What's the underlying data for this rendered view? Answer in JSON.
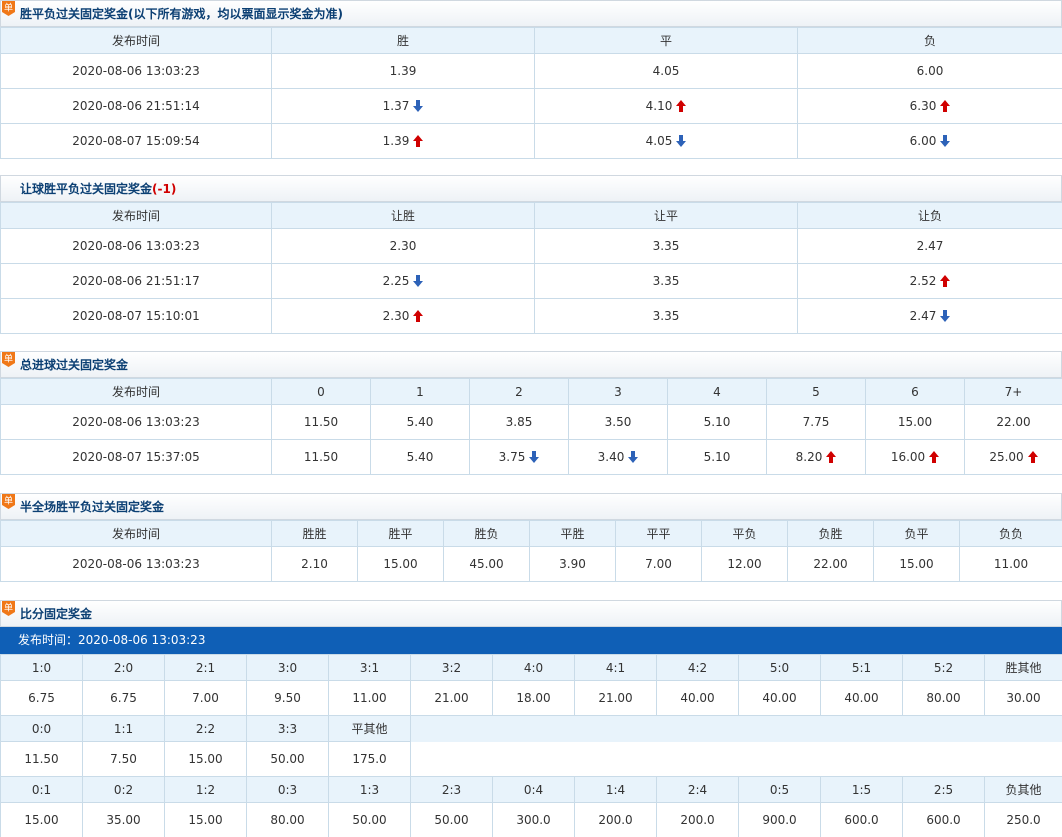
{
  "s1": {
    "title": "胜平负过关固定奖金(以下所有游戏，均以票面显示奖金为准)",
    "headers": [
      "发布时间",
      "胜",
      "平",
      "负"
    ],
    "rows": [
      [
        "2020-08-06 13:03:23",
        "1.39",
        "",
        "4.05",
        "",
        "6.00",
        ""
      ],
      [
        "2020-08-06 21:51:14",
        "1.37",
        "down",
        "4.10",
        "up",
        "6.30",
        "up"
      ],
      [
        "2020-08-07 15:09:54",
        "1.39",
        "up",
        "4.05",
        "down",
        "6.00",
        "down"
      ]
    ]
  },
  "s2": {
    "title": "让球胜平负过关固定奖金",
    "handicap": "(-1)",
    "headers": [
      "发布时间",
      "让胜",
      "让平",
      "让负"
    ],
    "rows": [
      [
        "2020-08-06 13:03:23",
        "2.30",
        "",
        "3.35",
        "",
        "2.47",
        ""
      ],
      [
        "2020-08-06 21:51:17",
        "2.25",
        "down",
        "3.35",
        "",
        "2.52",
        "up"
      ],
      [
        "2020-08-07 15:10:01",
        "2.30",
        "up",
        "3.35",
        "",
        "2.47",
        "down"
      ]
    ]
  },
  "s3": {
    "title": "总进球过关固定奖金",
    "headers": [
      "发布时间",
      "0",
      "1",
      "2",
      "3",
      "4",
      "5",
      "6",
      "7+"
    ],
    "rows": [
      {
        "time": "2020-08-06 13:03:23",
        "cells": [
          [
            "11.50",
            ""
          ],
          [
            "5.40",
            ""
          ],
          [
            "3.85",
            ""
          ],
          [
            "3.50",
            ""
          ],
          [
            "5.10",
            ""
          ],
          [
            "7.75",
            ""
          ],
          [
            "15.00",
            ""
          ],
          [
            "22.00",
            ""
          ]
        ]
      },
      {
        "time": "2020-08-07 15:37:05",
        "cells": [
          [
            "11.50",
            ""
          ],
          [
            "5.40",
            ""
          ],
          [
            "3.75",
            "down"
          ],
          [
            "3.40",
            "down"
          ],
          [
            "5.10",
            ""
          ],
          [
            "8.20",
            "up"
          ],
          [
            "16.00",
            "up"
          ],
          [
            "25.00",
            "up"
          ]
        ]
      }
    ]
  },
  "s4": {
    "title": "半全场胜平负过关固定奖金",
    "headers": [
      "发布时间",
      "胜胜",
      "胜平",
      "胜负",
      "平胜",
      "平平",
      "平负",
      "负胜",
      "负平",
      "负负"
    ],
    "row": [
      "2020-08-06 13:03:23",
      "2.10",
      "15.00",
      "45.00",
      "3.90",
      "7.00",
      "12.00",
      "22.00",
      "15.00",
      "11.00"
    ]
  },
  "s5": {
    "title": "比分固定奖金",
    "publish": "发布时间：2020-08-06 13:03:23",
    "win_scores": [
      "1:0",
      "2:0",
      "2:1",
      "3:0",
      "3:1",
      "3:2",
      "4:0",
      "4:1",
      "4:2",
      "5:0",
      "5:1",
      "5:2",
      "胜其他"
    ],
    "win_odds": [
      "6.75",
      "6.75",
      "7.00",
      "9.50",
      "11.00",
      "21.00",
      "18.00",
      "21.00",
      "40.00",
      "40.00",
      "40.00",
      "80.00",
      "30.00"
    ],
    "draw_scores": [
      "0:0",
      "1:1",
      "2:2",
      "3:3",
      "平其他"
    ],
    "draw_odds": [
      "11.50",
      "7.50",
      "15.00",
      "50.00",
      "175.0"
    ],
    "lose_scores": [
      "0:1",
      "0:2",
      "1:2",
      "0:3",
      "1:3",
      "2:3",
      "0:4",
      "1:4",
      "2:4",
      "0:5",
      "1:5",
      "2:5",
      "负其他"
    ],
    "lose_odds": [
      "15.00",
      "35.00",
      "15.00",
      "80.00",
      "50.00",
      "50.00",
      "300.0",
      "200.0",
      "200.0",
      "900.0",
      "600.0",
      "600.0",
      "250.0"
    ]
  },
  "colors": {
    "up": "#d00000",
    "down": "#2d62b8",
    "header_text": "#0b3f73",
    "bar": "#0f5fb6",
    "badge": "#f07818"
  }
}
